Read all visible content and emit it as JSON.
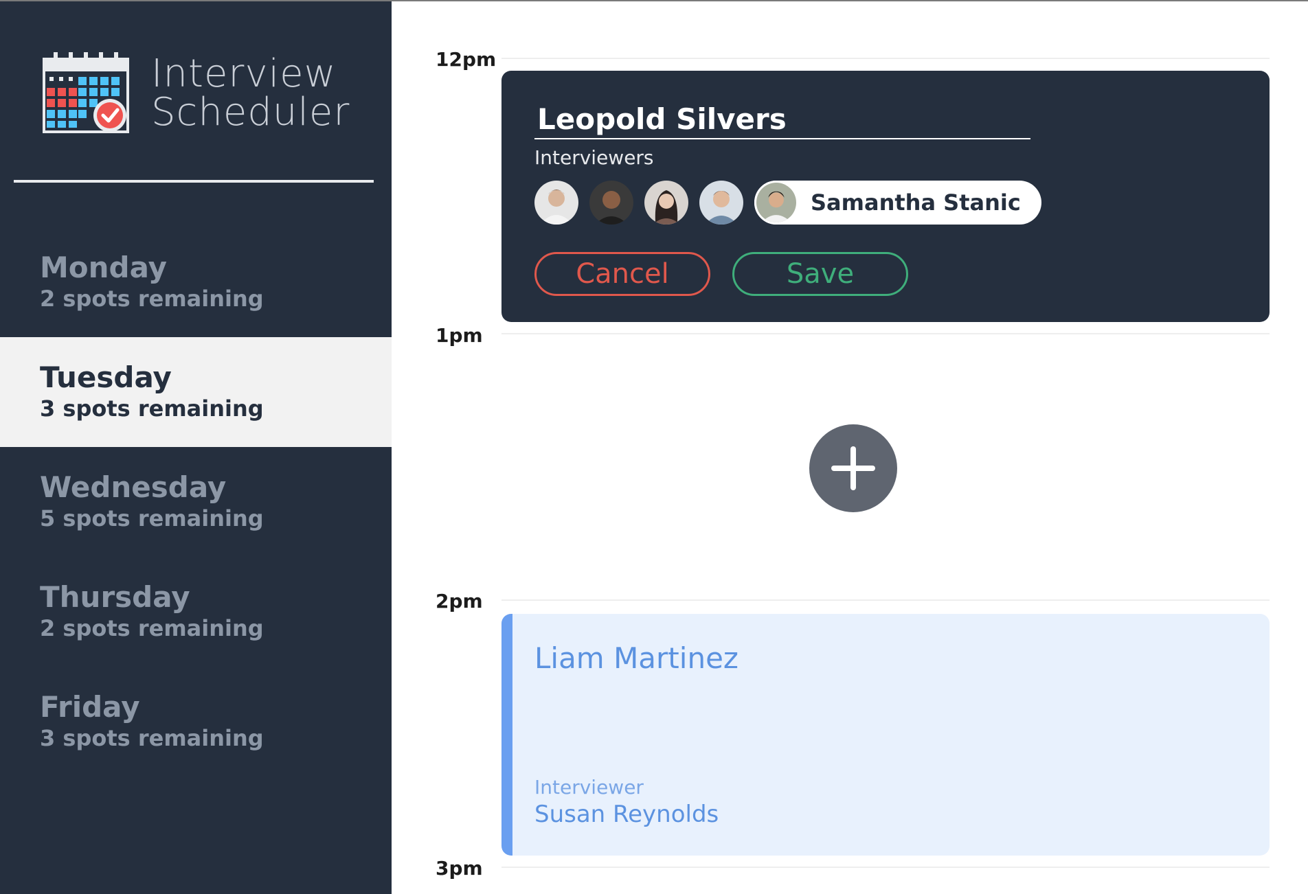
{
  "brand": {
    "title_line1": "Interview",
    "title_line2": "Scheduler",
    "logo_icon": "calendar-check-icon"
  },
  "days": [
    {
      "name": "Monday",
      "spots": "2 spots remaining",
      "selected": false
    },
    {
      "name": "Tuesday",
      "spots": "3 spots remaining",
      "selected": true
    },
    {
      "name": "Wednesday",
      "spots": "5 spots remaining",
      "selected": false
    },
    {
      "name": "Thursday",
      "spots": "2 spots remaining",
      "selected": false
    },
    {
      "name": "Friday",
      "spots": "3 spots remaining",
      "selected": false
    }
  ],
  "times": [
    "12pm",
    "1pm",
    "2pm",
    "3pm"
  ],
  "editor": {
    "student_name": "Leopold Silvers",
    "interviewers_label": "Interviewers",
    "selected_interviewer": "Samantha Stanic",
    "cancel_label": "Cancel",
    "save_label": "Save"
  },
  "add_button": {
    "icon": "plus-icon"
  },
  "appointment": {
    "student": "Liam Martinez",
    "interviewer_label": "Interviewer",
    "interviewer_name": "Susan Reynolds"
  },
  "colors": {
    "sidebar": "#252f3e",
    "selected_day_bg": "#f2f2f2",
    "cancel": "#e0584c",
    "save": "#3fae7b",
    "appointment_accent": "#6a9ff0",
    "appointment_bg": "#e8f1fd"
  }
}
